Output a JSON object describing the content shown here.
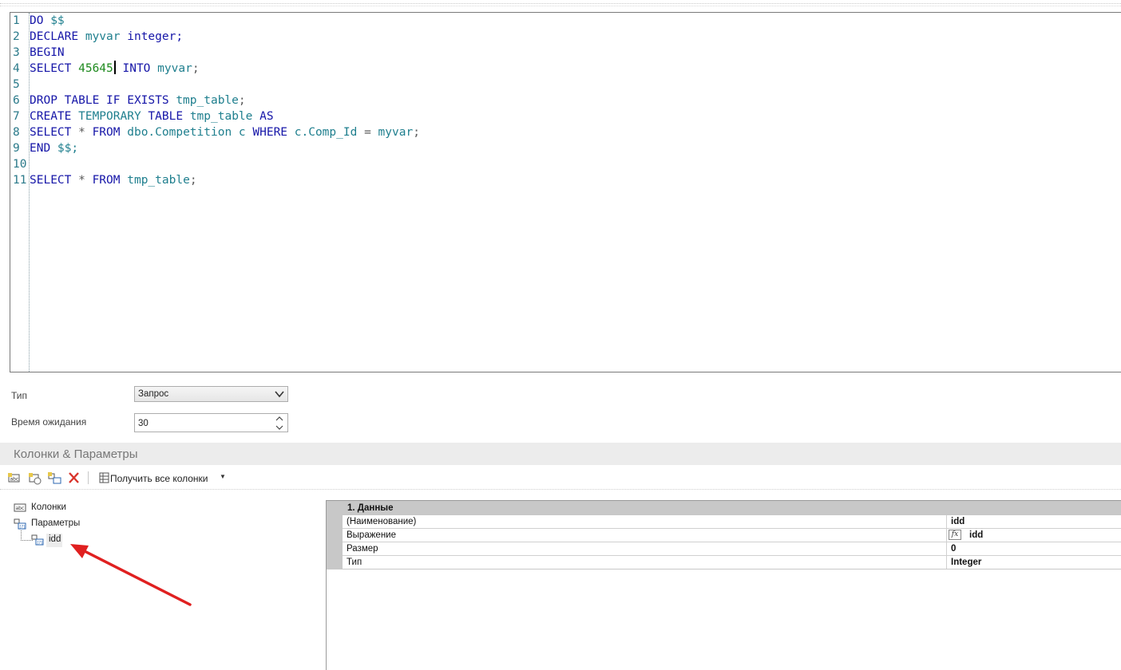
{
  "editor": {
    "lines": [
      {
        "n": "1",
        "tokens": [
          {
            "t": "DO ",
            "c": "kw"
          },
          {
            "t": "$$",
            "c": "id"
          }
        ]
      },
      {
        "n": "2",
        "tokens": [
          {
            "t": "DECLARE ",
            "c": "kw"
          },
          {
            "t": "myvar ",
            "c": "id"
          },
          {
            "t": "integer;",
            "c": "kw"
          }
        ]
      },
      {
        "n": "3",
        "tokens": [
          {
            "t": "BEGIN",
            "c": "kw"
          }
        ]
      },
      {
        "n": "4",
        "tokens": [
          {
            "t": "SELECT ",
            "c": "kw"
          },
          {
            "t": "45645",
            "c": "num"
          },
          {
            "t": "",
            "c": "caret"
          },
          {
            "t": " INTO ",
            "c": "kw"
          },
          {
            "t": "myvar",
            "c": "id"
          },
          {
            "t": ";",
            "c": "op"
          }
        ]
      },
      {
        "n": "5",
        "tokens": []
      },
      {
        "n": "6",
        "tokens": [
          {
            "t": "DROP TABLE IF EXISTS ",
            "c": "kw"
          },
          {
            "t": "tmp_table",
            "c": "id"
          },
          {
            "t": ";",
            "c": "op"
          }
        ]
      },
      {
        "n": "7",
        "tokens": [
          {
            "t": "CREATE ",
            "c": "kw"
          },
          {
            "t": "TEMPORARY ",
            "c": "id"
          },
          {
            "t": "TABLE ",
            "c": "kw"
          },
          {
            "t": "tmp_table ",
            "c": "id"
          },
          {
            "t": "AS",
            "c": "kw"
          }
        ]
      },
      {
        "n": "8",
        "tokens": [
          {
            "t": "SELECT ",
            "c": "kw"
          },
          {
            "t": "* ",
            "c": "op"
          },
          {
            "t": "FROM ",
            "c": "kw"
          },
          {
            "t": "dbo.Competition c ",
            "c": "id"
          },
          {
            "t": "WHERE ",
            "c": "kw"
          },
          {
            "t": "c.Comp_Id ",
            "c": "id"
          },
          {
            "t": "= ",
            "c": "op"
          },
          {
            "t": "myvar",
            "c": "id"
          },
          {
            "t": ";",
            "c": "op"
          }
        ]
      },
      {
        "n": "9",
        "tokens": [
          {
            "t": "END ",
            "c": "kw"
          },
          {
            "t": "$$;",
            "c": "id"
          }
        ]
      },
      {
        "n": "10",
        "tokens": []
      },
      {
        "n": "11",
        "tokens": [
          {
            "t": "SELECT ",
            "c": "kw"
          },
          {
            "t": "* ",
            "c": "op"
          },
          {
            "t": "FROM ",
            "c": "kw"
          },
          {
            "t": "tmp_table",
            "c": "id"
          },
          {
            "t": ";",
            "c": "op"
          }
        ]
      }
    ]
  },
  "form": {
    "type_label": "Тип",
    "type_value": "Запрос",
    "timeout_label": "Время ожидания",
    "timeout_value": "30"
  },
  "section": {
    "title": "Колонки & Параметры"
  },
  "toolbar": {
    "get_all_columns": "Получить все колонки"
  },
  "tree": {
    "columns": "Колонки",
    "parameters": "Параметры",
    "param_idd": "idd"
  },
  "grid": {
    "category": "1. Данные",
    "rows": [
      {
        "key": "(Наименование)",
        "value": "idd"
      },
      {
        "key": "Выражение",
        "value": "idd"
      },
      {
        "key": "Размер",
        "value": "0"
      },
      {
        "key": "Тип",
        "value": "Integer"
      }
    ],
    "fx_label": "fx"
  },
  "colors": {
    "keyword": "#1616a8",
    "identifier": "#1f7f8e",
    "number": "#1e8a1e",
    "annotation_arrow": "#e02020"
  }
}
